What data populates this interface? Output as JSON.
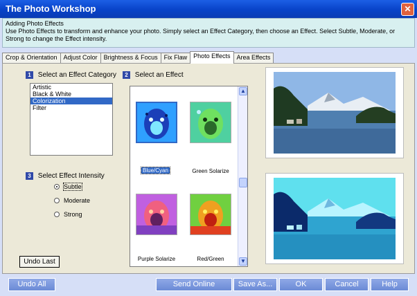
{
  "window": {
    "title": "The Photo Workshop",
    "close_symbol": "✕"
  },
  "info": {
    "heading": "Adding Photo Effects",
    "text": "Use Photo Effects to transform and enhance your photo.  Simply select an Effect Category, then choose an Effect.  Select Subtle, Moderate, or Strong to change the Effect intensity."
  },
  "tabs": [
    "Crop & Orientation",
    "Adjust Color",
    "Brightness & Focus",
    "Fix Flaw",
    "Photo Effects",
    "Area Effects"
  ],
  "category": {
    "step": "1",
    "label": "Select an Effect Category",
    "items": [
      "Artistic",
      "Black & White",
      "Colorization",
      "Filter"
    ],
    "selected": "Colorization"
  },
  "intensity": {
    "step": "3",
    "label": "Select Effect Intensity",
    "options": [
      "Subtle",
      "Moderate",
      "Strong"
    ],
    "selected": "Subtle"
  },
  "effects": {
    "step": "2",
    "label": "Select an Effect",
    "items": [
      "Blue/Cyan",
      "Green Solarize",
      "Purple Solarize",
      "Red/Green"
    ],
    "selected": "Blue/Cyan"
  },
  "buttons": {
    "undo_last": "Undo Last",
    "undo_all": "Undo All",
    "send_online": "Send Online",
    "save_as": "Save As...",
    "ok": "OK",
    "cancel": "Cancel",
    "help": "Help"
  },
  "colors": {
    "titlebar": "#0843c8",
    "selection": "#3169c6",
    "bottom_button": "#7b98dc"
  }
}
